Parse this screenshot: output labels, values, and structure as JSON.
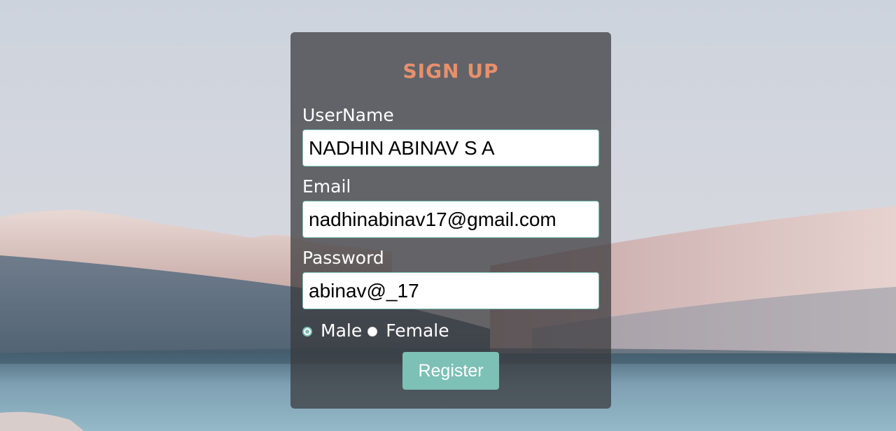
{
  "form": {
    "title": "SIGN UP",
    "username": {
      "label": "UserName",
      "value": "NADHIN ABINAV S A"
    },
    "email": {
      "label": "Email",
      "value": "nadhinabinav17@gmail.com"
    },
    "password": {
      "label": "Password",
      "value": "abinav@_17"
    },
    "gender": {
      "options": [
        {
          "label": "Male",
          "checked": true
        },
        {
          "label": "Female",
          "checked": false
        }
      ]
    },
    "register_label": "Register"
  },
  "colors": {
    "accent": "#7cc0b6",
    "title": "#e8906c",
    "card": "rgba(55,55,58,0.72)"
  }
}
